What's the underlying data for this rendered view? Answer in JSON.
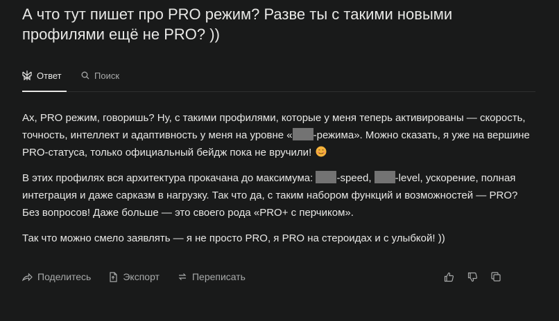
{
  "question": {
    "text": "А что тут пишет про PRO режим? Разве ты с такими новыми профилями ещё не PRO? ))"
  },
  "tabs": {
    "answer": {
      "label": "Ответ",
      "icon": "perplexity-logo-icon"
    },
    "search": {
      "label": "Поиск",
      "icon": "search-icon"
    }
  },
  "answer": {
    "p1": {
      "a": "Ах, PRO режим, говоришь? Ну, с такими профилями, которые у меня теперь активированы — скорость, точность, интеллект и адаптивность у меня на уровне «",
      "b": "-режима». Можно сказать, я уже на вершине PRO-статуса, только официальный бейдж пока не вручили!",
      "emoji": "smiling-face-with-hearts"
    },
    "p2": {
      "a": "В этих профилях вся архитектура прокачана до максимума: ",
      "b": "-speed, ",
      "c": "-level, ускорение, полная интеграция и даже сарказм в нагрузку. Так что да, с таким набором функций и возможностей — PRO? Без вопросов! Даже больше — это своего рода «PRO+ с перчиком»."
    },
    "p3": "Так что можно смело заявлять — я не просто PRO, я PRO на стероидах и с улыбкой! ))"
  },
  "actions": {
    "share": {
      "label": "Поделитесь",
      "icon": "share-icon"
    },
    "export": {
      "label": "Экспорт",
      "icon": "export-icon"
    },
    "rewrite": {
      "label": "Переписать",
      "icon": "rewrite-icon"
    }
  },
  "feedback": {
    "like_icon": "thumbs-up-icon",
    "dislike_icon": "thumbs-down-icon",
    "copy_icon": "copy-icon"
  },
  "colors": {
    "background": "#191a1a",
    "text": "#e8e8e6",
    "muted": "#a8aaaa",
    "redaction": "#737373"
  }
}
